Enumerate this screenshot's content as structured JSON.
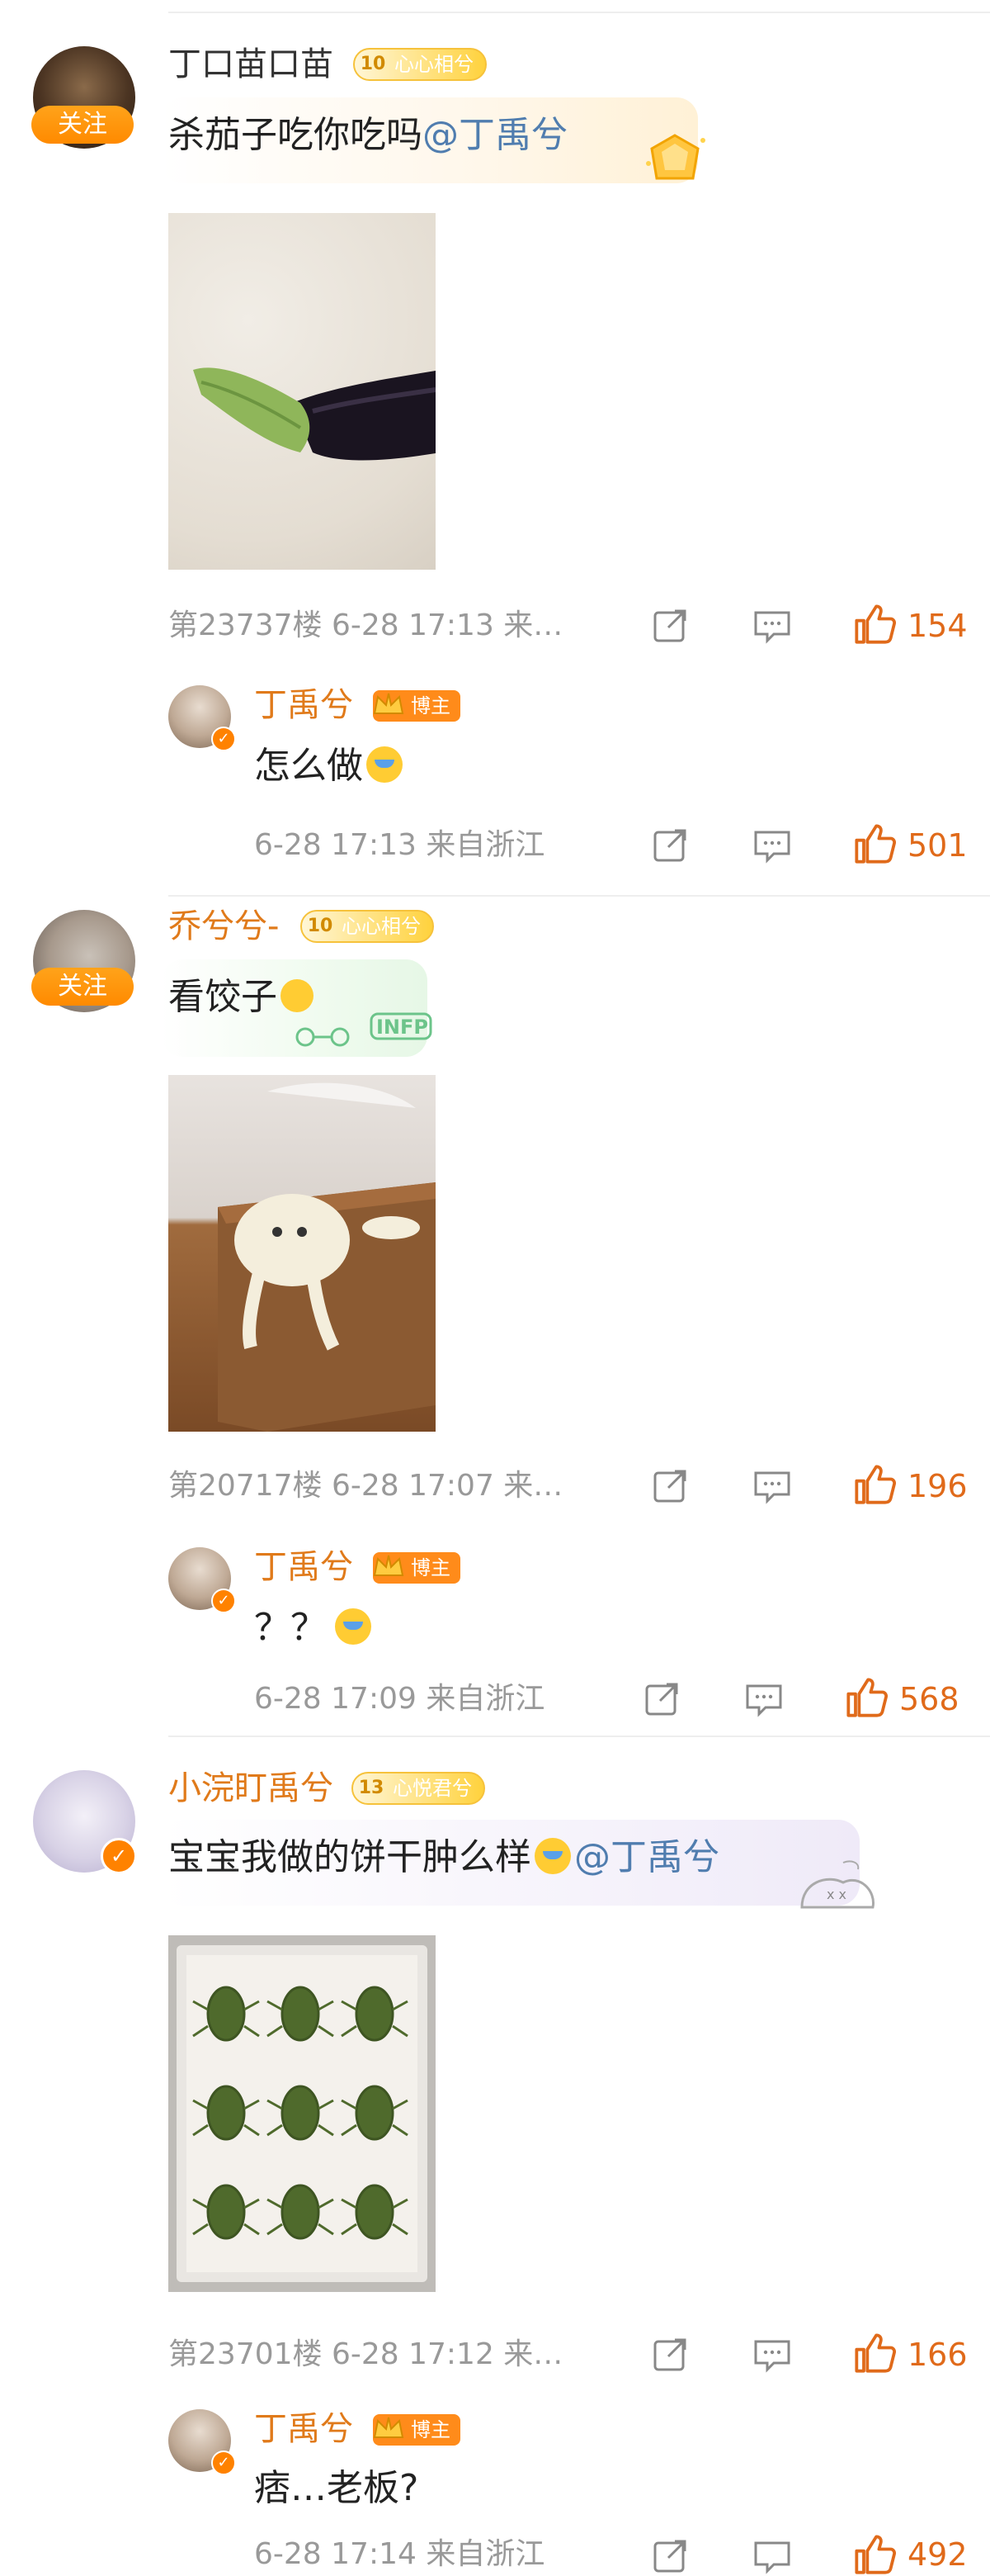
{
  "labels": {
    "follow": "关注",
    "owner_badge": "博主"
  },
  "colors": {
    "accent": "#ff8200",
    "mention": "#507daf",
    "meta": "#999999",
    "like": "#e06a1a"
  },
  "comments": [
    {
      "user": "丁口苗口苗",
      "fan_level": "10",
      "fan_badge": "心心相兮",
      "text": "杀茄子吃你吃吗",
      "mention": "@丁禹兮",
      "image": "eggplant-photo",
      "meta": "第23737楼 6-28 17:13 来…",
      "likes": "154",
      "reply": {
        "user": "丁禹兮",
        "text": "怎么做",
        "emoji": "crying-face",
        "meta": "6-28 17:13 来自浙江",
        "likes": "501"
      }
    },
    {
      "user": "乔兮兮-",
      "fan_level": "10",
      "fan_badge": "心心相兮",
      "text": "看饺子",
      "emoji": "smiling-face",
      "image": "dumpling-photo",
      "meta": "第20717楼 6-28 17:07 来…",
      "likes": "196",
      "reply": {
        "user": "丁禹兮",
        "text": "？？",
        "emoji": "crying-face",
        "meta": "6-28 17:09 来自浙江",
        "likes": "568"
      }
    },
    {
      "user": "小浣盯禹兮",
      "fan_level": "13",
      "fan_badge": "心悦君兮",
      "text": "宝宝我做的饼干肿么样",
      "emoji": "crying-face",
      "mention": "@丁禹兮",
      "image": "cookie-tray-photo",
      "meta": "第23701楼 6-28 17:12 来…",
      "likes": "166",
      "reply": {
        "user": "丁禹兮",
        "text": "痞…老板?",
        "meta": "6-28 17:14 来自浙江",
        "likes": "492"
      }
    }
  ]
}
